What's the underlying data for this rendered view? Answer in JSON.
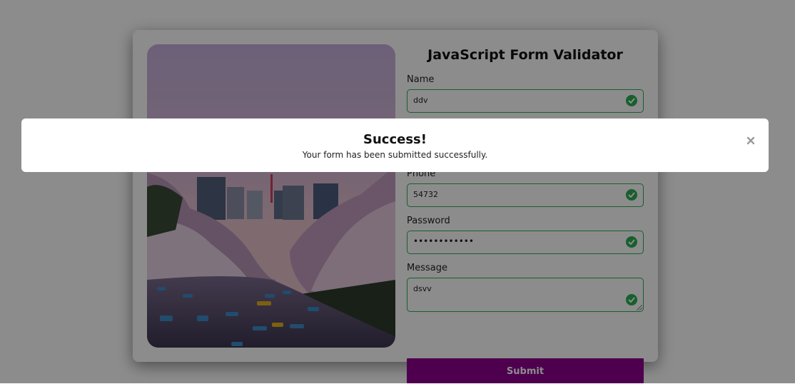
{
  "form": {
    "title": "JavaScript Form Validator",
    "fields": {
      "name": {
        "label": "Name",
        "value": "ddv"
      },
      "phone": {
        "label": "Phone",
        "value": "54732"
      },
      "password": {
        "label": "Password",
        "value": "••••••••••••"
      },
      "message": {
        "label": "Message",
        "value": "dsvv"
      }
    },
    "submit_label": "Submit",
    "valid_icon": "check-circle-icon"
  },
  "modal": {
    "title": "Success!",
    "message": "Your form has been submitted successfully.",
    "close_icon": "close-icon"
  },
  "colors": {
    "valid_border": "#2ab052",
    "submit_bg": "#8e008e",
    "overlay": "rgba(0,0,0,0.45)"
  }
}
